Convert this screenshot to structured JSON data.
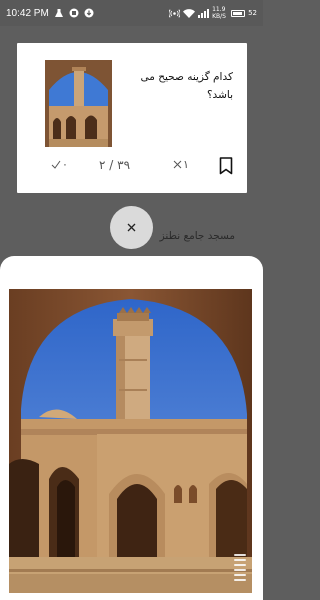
{
  "status_bar": {
    "time": "10:42 PM",
    "network_speed": "11.9 KB/S",
    "battery_level": "52"
  },
  "question": {
    "text": "کدام گزینه صحیح می باشد؟",
    "image_icon": "mosque-minaret-photo"
  },
  "footer": {
    "correct_count": "۰",
    "progress": "۲ / ۳۹",
    "wrong_count": "۱",
    "bookmark_icon": "bookmark-icon"
  },
  "background_answer": "مسجد جامع نطنز",
  "close_icon": "close-icon",
  "expanded_image": "mosque-minaret-photo",
  "colors": {
    "overlay": "#5e5e5e",
    "card": "#ffffff",
    "sky": "#4a7fd8",
    "mud_brick": "#b98a5c"
  }
}
